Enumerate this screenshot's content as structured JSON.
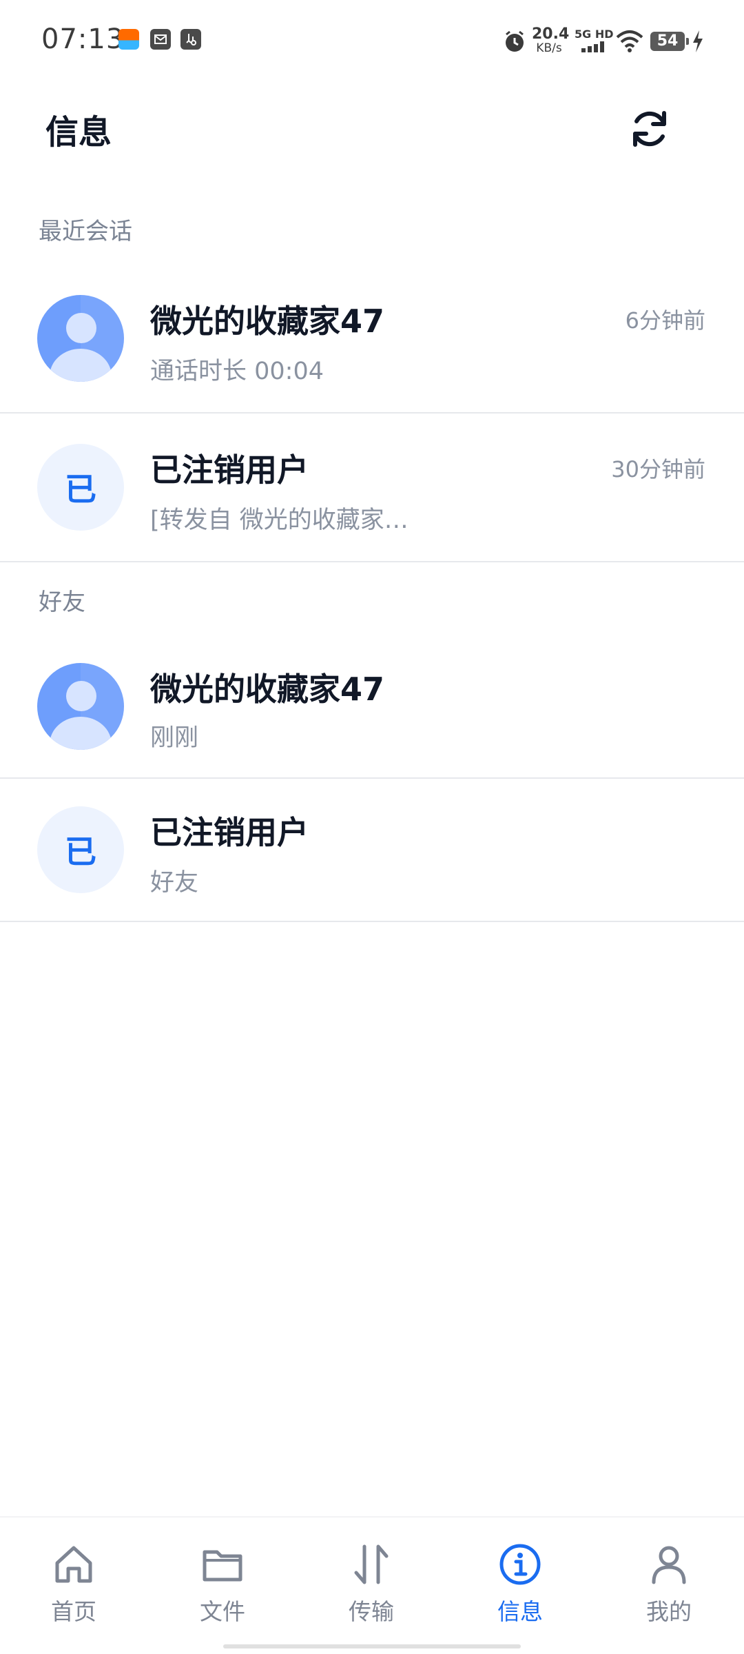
{
  "status_bar": {
    "time": "07:13",
    "speed_value": "20.4",
    "speed_unit": "KB/s",
    "network": "5G HD",
    "battery": "54"
  },
  "header": {
    "title": "信息",
    "refresh_icon": "refresh-icon"
  },
  "sections": {
    "recent_label": "最近会话",
    "friends_label": "好友"
  },
  "recent": [
    {
      "name": "微光的收藏家47",
      "subtitle": "通话时长 00:04",
      "time": "6分钟前",
      "avatar": "user-avatar"
    },
    {
      "name": "已注销用户",
      "subtitle": "[转发自 微光的收藏家…",
      "time": "30分钟前",
      "avatar_letter": "已"
    }
  ],
  "friends": [
    {
      "name": "微光的收藏家47",
      "subtitle": "刚刚",
      "avatar": "user-avatar"
    },
    {
      "name": "已注销用户",
      "subtitle": "好友",
      "avatar_letter": "已"
    }
  ],
  "nav": {
    "items": [
      {
        "label": "首页",
        "icon": "home-icon"
      },
      {
        "label": "文件",
        "icon": "folder-icon"
      },
      {
        "label": "传输",
        "icon": "transfer-icon"
      },
      {
        "label": "信息",
        "icon": "info-icon"
      },
      {
        "label": "我的",
        "icon": "profile-icon"
      }
    ],
    "active_index": 3
  },
  "colors": {
    "accent": "#1a6cf0",
    "muted": "#8a92a0",
    "avatar_blue": "#6e9efc"
  }
}
